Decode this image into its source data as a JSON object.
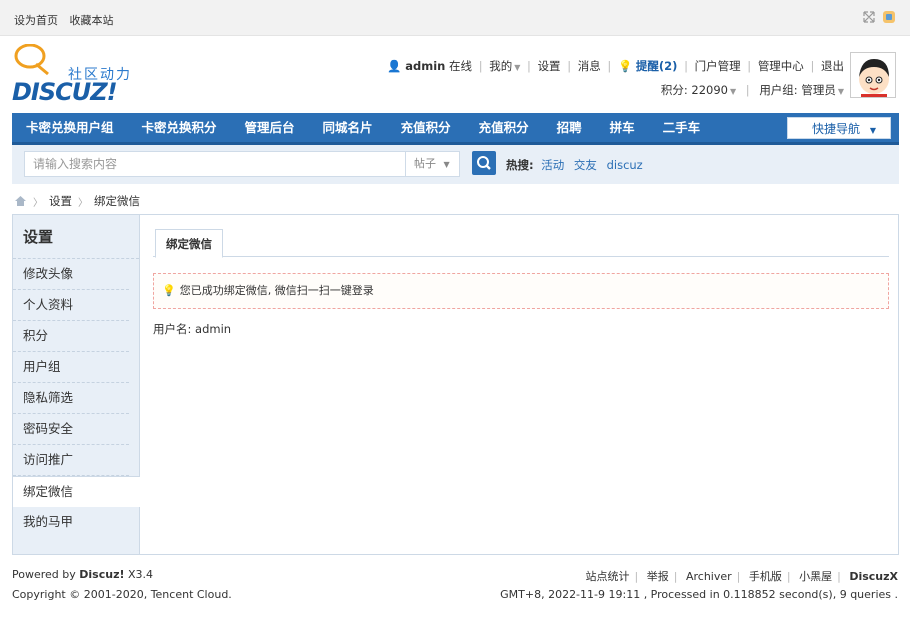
{
  "topbar": {
    "set_home": "设为首页",
    "bookmark": "收藏本站",
    "icons": [
      "resize-icon",
      "app-icon"
    ]
  },
  "logo": {
    "slogan": "社区动力",
    "brand": "DISCUZ!"
  },
  "user": {
    "name": "admin",
    "status": "在线",
    "my": "我的",
    "settings": "设置",
    "messages": "消息",
    "remind": "提醒(2)",
    "portal_admin": "门户管理",
    "admin_center": "管理中心",
    "logout": "退出",
    "points": "积分: 22090",
    "group": "用户组: 管理员"
  },
  "nav": {
    "items": [
      "卡密兑换用户组",
      "卡密兑换积分",
      "管理后台",
      "同城名片",
      "充值积分",
      "充值积分",
      "招聘",
      "拼车",
      "二手车"
    ],
    "quick_nav": "快捷导航"
  },
  "search": {
    "placeholder": "请输入搜索内容",
    "type": "帖子",
    "hot_label": "热搜:",
    "hot_items": [
      "活动",
      "交友",
      "discuz"
    ]
  },
  "breadcrumb": {
    "items": [
      "设置",
      "绑定微信"
    ]
  },
  "sidebar": {
    "title": "设置",
    "items": [
      "修改头像",
      "个人资料",
      "积分",
      "用户组",
      "隐私筛选",
      "密码安全",
      "访问推广",
      "绑定微信",
      "我的马甲"
    ],
    "active_index": 7
  },
  "content": {
    "tab": "绑定微信",
    "notice": "您已成功绑定微信, 微信扫一扫一键登录",
    "username_line": "用户名: admin"
  },
  "footer": {
    "powered_prefix": "Powered by",
    "powered_brand": "Discuz!",
    "version": "X3.4",
    "copyright": "Copyright © 2001-2020, Tencent Cloud.",
    "links": [
      "站点统计",
      "举报",
      "Archiver",
      "手机版",
      "小黑屋"
    ],
    "brand": "DiscuzX",
    "stats": "GMT+8, 2022-11-9 19:11 , Processed in 0.118852 second(s), 9 queries ."
  },
  "colors": {
    "nav_blue": "#2b6fb5",
    "light_blue_bg": "#e8eff7",
    "notice_border": "#f0a5a0"
  }
}
